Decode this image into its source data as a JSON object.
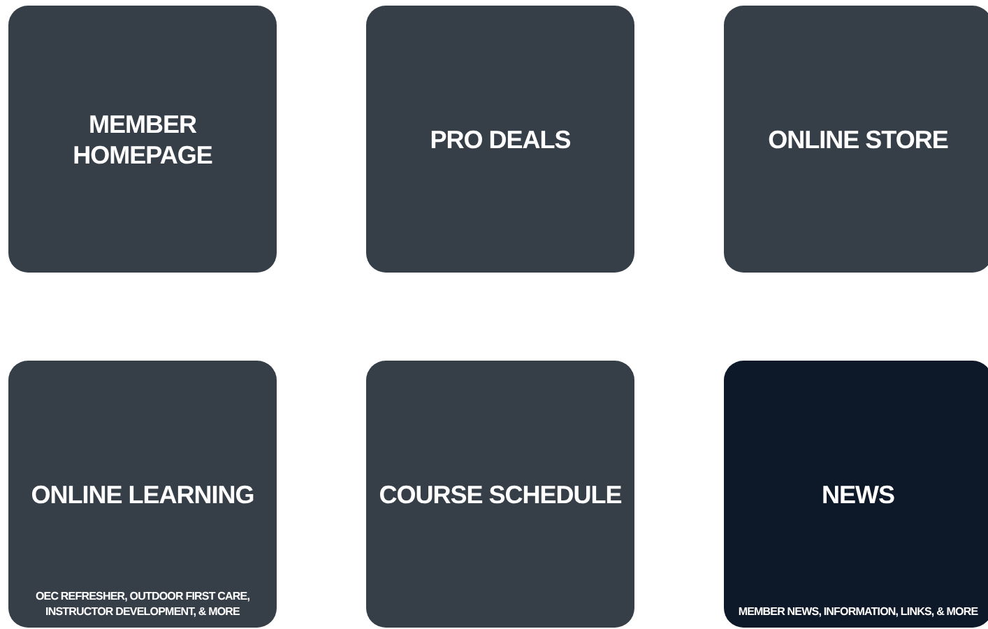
{
  "tiles": [
    {
      "title": "MEMBER\nHOMEPAGE",
      "selected": false
    },
    {
      "title": "PRO DEALS",
      "selected": false
    },
    {
      "title": "ONLINE STORE",
      "selected": false
    },
    {
      "title": "ONLINE LEARNING",
      "subtitle": "OEC REFRESHER, OUTDOOR FIRST CARE,\nINSTRUCTOR DEVELOPMENT, & MORE",
      "selected": false
    },
    {
      "title": "COURSE SCHEDULE",
      "selected": false
    },
    {
      "title": "NEWS",
      "subtitle": "MEMBER NEWS, INFORMATION, LINKS, & MORE",
      "selected": true
    }
  ]
}
